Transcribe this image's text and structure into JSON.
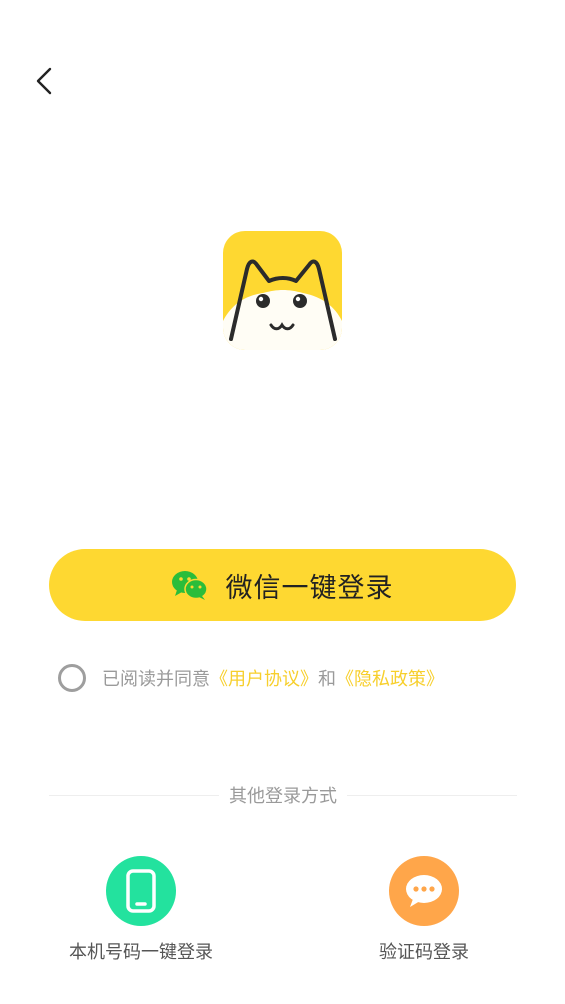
{
  "colors": {
    "accent": "#fed831",
    "link": "#f7cf2c",
    "phone_circle": "#23e29e",
    "sms_circle": "#ffa64a",
    "wechat_green": "#2bbd3a"
  },
  "login": {
    "wechat_label": "微信一键登录",
    "wechat_icon": "wechat-icon"
  },
  "agreement": {
    "prefix": "已阅读并同意",
    "user_agreement": "《用户协议》",
    "conjunction": "和",
    "privacy_policy": "《隐私政策》"
  },
  "other": {
    "divider_text": "其他登录方式",
    "methods": [
      {
        "label": "本机号码一键登录",
        "icon": "phone-icon"
      },
      {
        "label": "验证码登录",
        "icon": "chat-bubble-icon"
      }
    ]
  }
}
